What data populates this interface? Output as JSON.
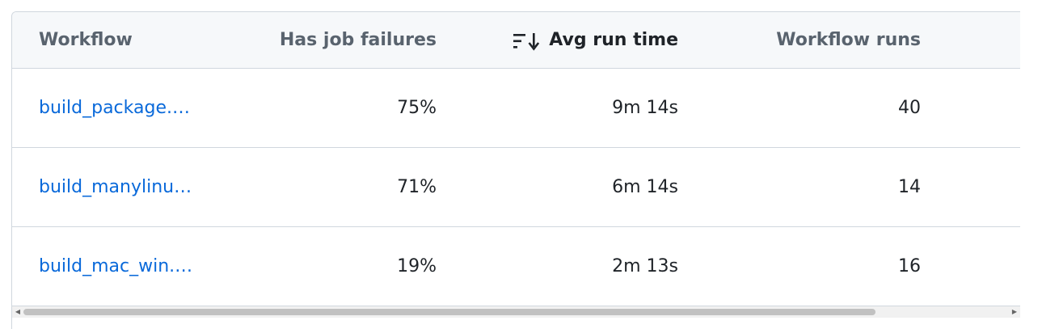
{
  "table": {
    "columns": [
      {
        "label": "Workflow"
      },
      {
        "label": "Has job failures"
      },
      {
        "label": "Avg run time",
        "sorted": "descending",
        "icon": "sort-descending-icon"
      },
      {
        "label": "Workflow runs"
      }
    ],
    "rows": [
      {
        "workflow": "build_package.…",
        "failures": "75%",
        "avg_run_time": "9m 14s",
        "runs": "40"
      },
      {
        "workflow": "build_manylinu…",
        "failures": "71%",
        "avg_run_time": "6m 14s",
        "runs": "14"
      },
      {
        "workflow": "build_mac_win.…",
        "failures": "19%",
        "avg_run_time": "2m 13s",
        "runs": "16"
      }
    ]
  },
  "colors": {
    "link": "#0969da",
    "header_bg": "#f6f8fa",
    "border": "#d0d7de",
    "header_text": "#59636e",
    "text": "#1f2328"
  }
}
